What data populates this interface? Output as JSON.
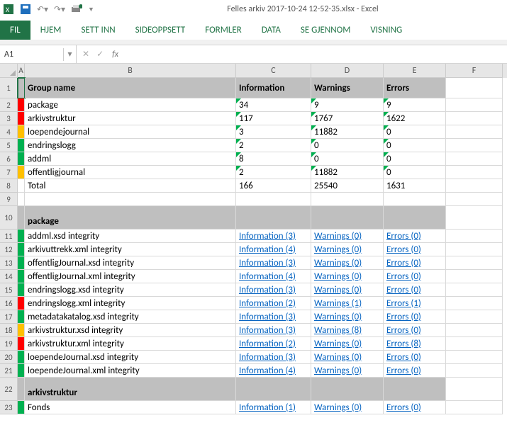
{
  "window_title": "Felles arkiv 2017-10-24 12-52-35.xlsx - Excel",
  "ribbon": {
    "file": "FIL",
    "home": "HJEM",
    "insert": "SETT INN",
    "page_layout": "SIDEOPPSETT",
    "formulas": "FORMLER",
    "data": "DATA",
    "review": "SE GJENNOM",
    "view": "VISNING"
  },
  "namebox": "A1",
  "fx_label": "fx",
  "columns": {
    "A": "A",
    "B": "B",
    "C": "C",
    "D": "D",
    "E": "E",
    "F": "F"
  },
  "headers": {
    "group": "Group name",
    "info": "Information",
    "warn": "Warnings",
    "err": "Errors"
  },
  "summary": [
    {
      "row": 2,
      "color": "red",
      "name": "package",
      "info": "34",
      "warn": "9",
      "err": "9"
    },
    {
      "row": 3,
      "color": "red",
      "name": "arkivstruktur",
      "info": "117",
      "warn": "1767",
      "err": "1622"
    },
    {
      "row": 4,
      "color": "orange",
      "name": "loependejournal",
      "info": "3",
      "warn": "11882",
      "err": "0"
    },
    {
      "row": 5,
      "color": "green",
      "name": "endringslogg",
      "info": "2",
      "warn": "0",
      "err": "0"
    },
    {
      "row": 6,
      "color": "green",
      "name": "addml",
      "info": "8",
      "warn": "0",
      "err": "0"
    },
    {
      "row": 7,
      "color": "orange",
      "name": "offentligjournal",
      "info": "2",
      "warn": "11882",
      "err": "0"
    },
    {
      "row": 8,
      "color": "none",
      "name": "Total",
      "info": "166",
      "warn": "25540",
      "err": "1631"
    }
  ],
  "section_package": "package",
  "package_rows": [
    {
      "row": 11,
      "color": "green",
      "name": "addml.xsd integrity",
      "info": "Information (3)",
      "warn": "Warnings (0)",
      "err": "Errors (0)"
    },
    {
      "row": 12,
      "color": "green",
      "name": "arkivuttrekk.xml integrity",
      "info": "Information (4)",
      "warn": "Warnings (0)",
      "err": "Errors (0)"
    },
    {
      "row": 13,
      "color": "green",
      "name": "offentligJournal.xsd integrity",
      "info": "Information (3)",
      "warn": "Warnings (0)",
      "err": "Errors (0)"
    },
    {
      "row": 14,
      "color": "green",
      "name": "offentligJournal.xml integrity",
      "info": "Information (4)",
      "warn": "Warnings (0)",
      "err": "Errors (0)"
    },
    {
      "row": 15,
      "color": "green",
      "name": "endringslogg.xsd integrity",
      "info": "Information (3)",
      "warn": "Warnings (0)",
      "err": "Errors (0)"
    },
    {
      "row": 16,
      "color": "red",
      "name": "endringslogg.xml integrity",
      "info": "Information (2)",
      "warn": "Warnings (1)",
      "err": "Errors (1)"
    },
    {
      "row": 17,
      "color": "green",
      "name": "metadatakatalog.xsd integrity",
      "info": "Information (3)",
      "warn": "Warnings (0)",
      "err": "Errors (0)"
    },
    {
      "row": 18,
      "color": "orange",
      "name": "arkivstruktur.xsd integrity",
      "info": "Information (3)",
      "warn": "Warnings (8)",
      "err": "Errors (0)"
    },
    {
      "row": 19,
      "color": "red",
      "name": "arkivstruktur.xml integrity",
      "info": "Information (2)",
      "warn": "Warnings (0)",
      "err": "Errors (8)"
    },
    {
      "row": 20,
      "color": "green",
      "name": "loependeJournal.xsd integrity",
      "info": "Information (3)",
      "warn": "Warnings (0)",
      "err": "Errors (0)"
    },
    {
      "row": 21,
      "color": "green",
      "name": "loependeJournal.xml integrity",
      "info": "Information (4)",
      "warn": "Warnings (0)",
      "err": "Errors (0)"
    }
  ],
  "section_arkiv": "arkivstruktur",
  "arkiv_rows": [
    {
      "row": 23,
      "color": "green",
      "name": "Fonds",
      "info": "Information (1)",
      "warn": "Warnings (0)",
      "err": "Errors (0)"
    }
  ]
}
